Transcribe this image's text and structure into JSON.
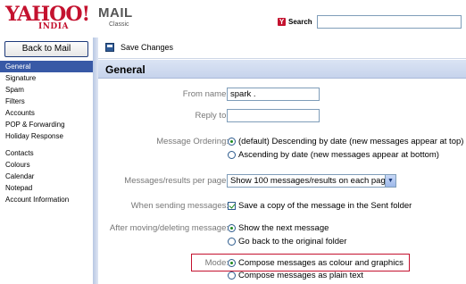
{
  "header": {
    "logo_text": "YAHOO!",
    "logo_sub": "INDIA",
    "mail_title": "MAIL",
    "mail_sub": "Classic",
    "search_label": "Search",
    "search_value": ""
  },
  "sidebar": {
    "back_button": "Back to Mail",
    "items": [
      {
        "label": "General",
        "selected": true
      },
      {
        "label": "Signature"
      },
      {
        "label": "Spam"
      },
      {
        "label": "Filters"
      },
      {
        "label": "Accounts"
      },
      {
        "label": "POP & Forwarding"
      },
      {
        "label": "Holiday Response"
      },
      {
        "label": "Contacts"
      },
      {
        "label": "Colours"
      },
      {
        "label": "Calendar"
      },
      {
        "label": "Notepad"
      },
      {
        "label": "Account Information"
      }
    ]
  },
  "toolbar": {
    "save_label": "Save Changes"
  },
  "section": {
    "title": "General"
  },
  "form": {
    "from_name_label": "From name:",
    "from_name_value": "spark .",
    "reply_to_label": "Reply to:",
    "reply_to_value": "",
    "ordering_label": "Message Ordering:",
    "ordering_options": [
      "(default) Descending by date (new messages appear at top)",
      "Ascending by date (new messages appear at bottom)"
    ],
    "ordering_selected": 0,
    "per_page_label": "Messages/results per page:",
    "per_page_value": "Show 100 messages/results on each page",
    "sending_label": "When sending messages:",
    "sending_option": "Save a copy of the message in the Sent folder",
    "sending_checked": true,
    "after_label": "After moving/deleting message:",
    "after_options": [
      "Show the next message",
      "Go back to the original folder"
    ],
    "after_selected": 0,
    "mode_label": "Mode:",
    "mode_options": [
      "Compose messages as colour and graphics",
      "Compose messages as plain text"
    ],
    "mode_selected": 0
  },
  "colors": {
    "brand_red": "#c4122f",
    "nav_selected": "#3859a6",
    "section_bar": "#c6d3ec"
  }
}
